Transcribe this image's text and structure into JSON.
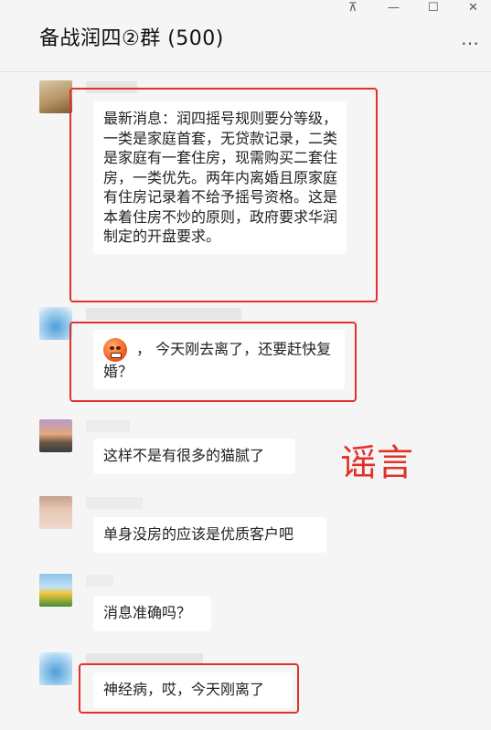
{
  "window": {
    "title": "备战润四②群 (500)",
    "pin_glyph": "⊼",
    "minimize_glyph": "—",
    "maximize_glyph": "☐",
    "close_glyph": "✕",
    "more_glyph": "…"
  },
  "messages": [
    {
      "text": "最新消息：润四摇号规则要分等级，一类是家庭首套，无贷款记录，二类是家庭有一套住房，现需购买二套住房，一类优先。两年内离婚且原家庭有住房记录着不给予摇号资格。这是本着住房不炒的原则，政府要求华润制定的开盘要求。"
    },
    {
      "text": "，  今天刚去离了，还要赶快复婚？"
    },
    {
      "text": "这样不是有很多的猫腻了"
    },
    {
      "text": "单身没房的应该是优质客户吧"
    },
    {
      "text": "消息准确吗？"
    },
    {
      "text": "神经病，哎，今天刚离了"
    }
  ],
  "annotation": {
    "label": "谣言",
    "color": "#e0322b"
  },
  "icons": [
    "pin-icon",
    "minimize-icon",
    "maximize-icon",
    "close-icon",
    "more-icon",
    "angry-emoji-icon"
  ]
}
